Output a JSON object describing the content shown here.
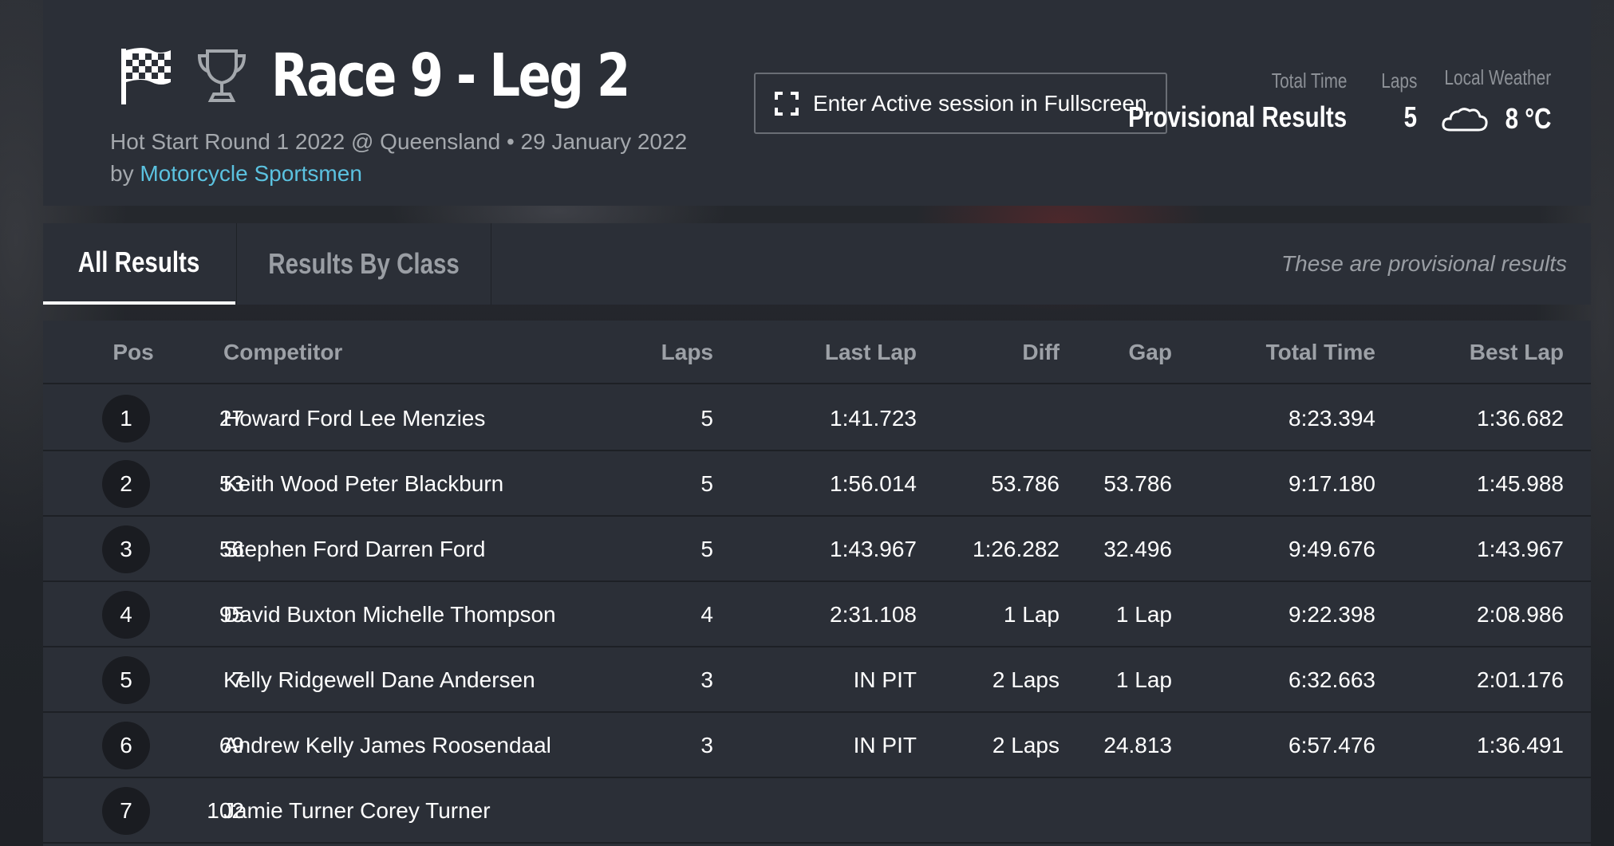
{
  "header": {
    "title": "Race 9 - Leg 2",
    "subtitle": "Hot Start Round 1 2022 @ Queensland • 29 January 2022",
    "by_prefix": "by",
    "organizer": "Motorcycle Sportsmen",
    "fullscreen_label": "Enter Active session in Fullscreen",
    "stats": {
      "total_time_label": "Total Time",
      "total_time_value": "Provisional Results",
      "laps_label": "Laps",
      "laps_value": "5",
      "weather_label": "Local Weather",
      "weather_value": "8 °C",
      "weather_icon": "cloud-icon"
    },
    "icons": [
      "checkered-flag-icon",
      "trophy-icon",
      "expand-icon"
    ]
  },
  "tabs": [
    {
      "label": "All Results",
      "active": true
    },
    {
      "label": "Results By Class",
      "active": false
    }
  ],
  "provisional_note": "These are provisional results",
  "table": {
    "columns": [
      "Pos",
      "Competitor",
      "Laps",
      "Last Lap",
      "Diff",
      "Gap",
      "Total Time",
      "Best Lap"
    ],
    "rows": [
      {
        "pos": "1",
        "num": "27",
        "competitor": "Howard Ford Lee Menzies",
        "laps": "5",
        "last_lap": "1:41.723",
        "diff": "",
        "gap": "",
        "total": "8:23.394",
        "best": "1:36.682"
      },
      {
        "pos": "2",
        "num": "53",
        "competitor": "Keith Wood Peter Blackburn",
        "laps": "5",
        "last_lap": "1:56.014",
        "diff": "53.786",
        "gap": "53.786",
        "total": "9:17.180",
        "best": "1:45.988"
      },
      {
        "pos": "3",
        "num": "56",
        "competitor": "Stephen Ford Darren Ford",
        "laps": "5",
        "last_lap": "1:43.967",
        "diff": "1:26.282",
        "gap": "32.496",
        "total": "9:49.676",
        "best": "1:43.967"
      },
      {
        "pos": "4",
        "num": "95",
        "competitor": "David Buxton Michelle Thompson",
        "laps": "4",
        "last_lap": "2:31.108",
        "diff": "1 Lap",
        "gap": "1 Lap",
        "total": "9:22.398",
        "best": "2:08.986"
      },
      {
        "pos": "5",
        "num": "7",
        "competitor": "Kelly Ridgewell Dane Andersen",
        "laps": "3",
        "last_lap": "IN PIT",
        "diff": "2 Laps",
        "gap": "1 Lap",
        "total": "6:32.663",
        "best": "2:01.176"
      },
      {
        "pos": "6",
        "num": "69",
        "competitor": "Andrew Kelly James Roosendaal",
        "laps": "3",
        "last_lap": "IN PIT",
        "diff": "2 Laps",
        "gap": "24.813",
        "total": "6:57.476",
        "best": "1:36.491"
      },
      {
        "pos": "7",
        "num": "102",
        "competitor": "Jamie Turner Corey Turner",
        "laps": "",
        "last_lap": "",
        "diff": "",
        "gap": "",
        "total": "",
        "best": ""
      }
    ]
  }
}
